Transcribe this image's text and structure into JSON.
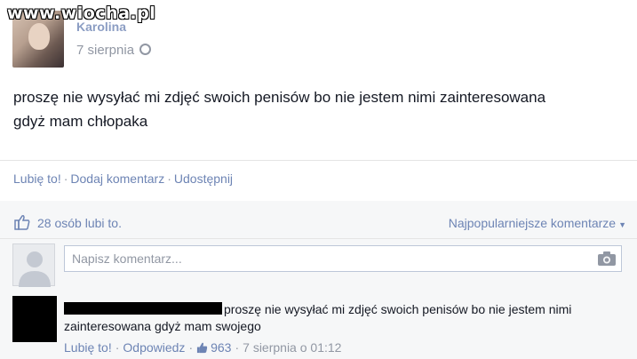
{
  "watermark": "www.wiocha.pl",
  "post": {
    "author_name": "Karolina",
    "date": "7 sierpnia",
    "text": "proszę nie wysyłać mi zdjęć swoich penisów bo nie jestem nimi zainteresowana gdyż mam chłopaka"
  },
  "actions": {
    "like": "Lubię to!",
    "comment": "Dodaj komentarz",
    "share": "Udostępnij"
  },
  "feedback": {
    "likes_text": "28 osób lubi to.",
    "sort_label": "Najpopularniejsze komentarze",
    "composer_placeholder": "Napisz komentarz..."
  },
  "comment": {
    "text": "proszę nie wysyłać mi zdjęć swoich penisów bo nie jestem nimi zainteresowana gdyż mam swojego",
    "like": "Lubię to!",
    "reply": "Odpowiedz",
    "like_count": "963",
    "timestamp": "7 sierpnia o 01:12"
  },
  "colors": {
    "link": "#6d84b4",
    "muted": "#9197a3",
    "feedback_bg": "#f6f7f8"
  }
}
